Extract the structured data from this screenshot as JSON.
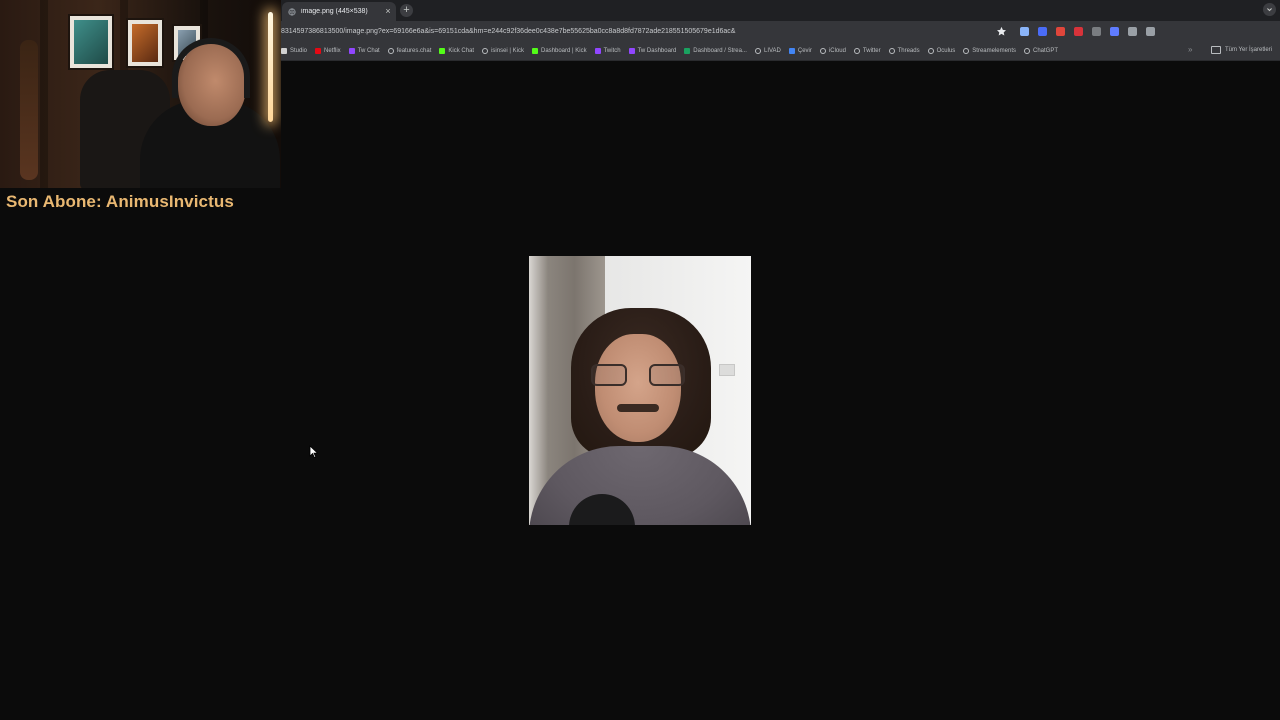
{
  "browser": {
    "tab": {
      "title": "image.png (445×538)",
      "close_glyph": "×"
    },
    "new_tab_glyph": "+",
    "address": {
      "url": "8314597386813500/image.png?ex=69166e6a&is=69151cda&hm=e244c92f36dee0c438e7be55625ba0cc8a8d8fd7872ade218551505679e1d6ac&"
    },
    "bookmarks": [
      {
        "label": "Studio",
        "color": "#d0d0d0"
      },
      {
        "label": "Netflix",
        "color": "#e50914"
      },
      {
        "label": "Tw Chat",
        "color": "#9146ff"
      },
      {
        "label": "features.chat",
        "color": "#b9bcbf"
      },
      {
        "label": "Kick Chat",
        "color": "#53fc18"
      },
      {
        "label": "isinsei | Kick",
        "color": "#b9bcbf"
      },
      {
        "label": "Dashboard | Kick",
        "color": "#53fc18"
      },
      {
        "label": "Twitch",
        "color": "#9146ff"
      },
      {
        "label": "Tw Dashboard",
        "color": "#9146ff"
      },
      {
        "label": "Dashboard / Strea...",
        "color": "#1aa260"
      },
      {
        "label": "LIVAD",
        "color": "#b9bcbf"
      },
      {
        "label": "Çevir",
        "color": "#4285f4"
      },
      {
        "label": "iCloud",
        "color": "#b9bcbf"
      },
      {
        "label": "Twitter",
        "color": "#b9bcbf"
      },
      {
        "label": "Threads",
        "color": "#b9bcbf"
      },
      {
        "label": "Oculus",
        "color": "#b9bcbf"
      },
      {
        "label": "Streamelements",
        "color": "#b9bcbf"
      },
      {
        "label": "ChatGPT",
        "color": "#b9bcbf"
      }
    ],
    "bookmarks_more": "»",
    "all_bookmarks": "Tüm Yer İşaretleri",
    "extension_colors": [
      "#8ab4f8",
      "#4a6cf7",
      "#e0463b",
      "#d8333a",
      "#7a7d81",
      "#5f7cff",
      "#9aa0a6",
      "#9aa0a6"
    ]
  },
  "stream_overlay": {
    "last_subscriber": "Son Abone: AnimusInvictus"
  }
}
